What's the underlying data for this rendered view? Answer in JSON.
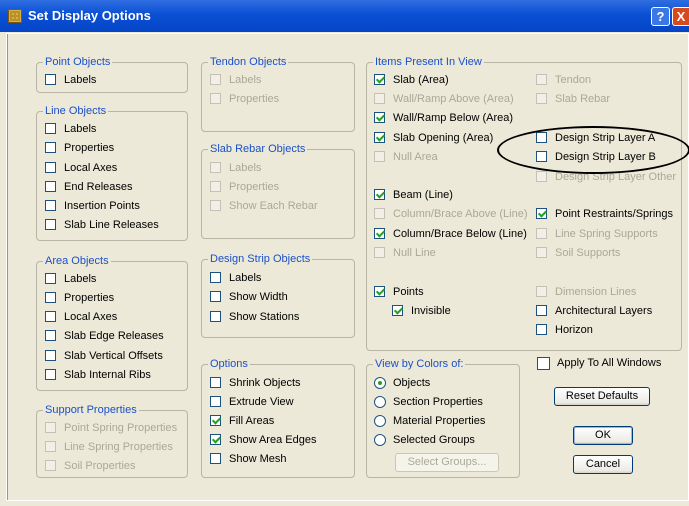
{
  "window": {
    "title": "Set Display Options",
    "help_label": "?",
    "close_label": "X"
  },
  "groups": {
    "point_objects": {
      "title": "Point Objects",
      "items": [
        {
          "label": "Labels",
          "checked": false
        }
      ]
    },
    "line_objects": {
      "title": "Line Objects",
      "items": [
        {
          "label": "Labels",
          "checked": false
        },
        {
          "label": "Properties",
          "checked": false
        },
        {
          "label": "Local Axes",
          "checked": false
        },
        {
          "label": "End Releases",
          "checked": false
        },
        {
          "label": "Insertion Points",
          "checked": false
        },
        {
          "label": "Slab Line Releases",
          "checked": false
        }
      ]
    },
    "area_objects": {
      "title": "Area Objects",
      "items": [
        {
          "label": "Labels",
          "checked": false
        },
        {
          "label": "Properties",
          "checked": false
        },
        {
          "label": "Local Axes",
          "checked": false
        },
        {
          "label": "Slab Edge Releases",
          "checked": false
        },
        {
          "label": "Slab Vertical Offsets",
          "checked": false
        },
        {
          "label": "Slab Internal Ribs",
          "checked": false
        }
      ]
    },
    "support_properties": {
      "title": "Support Properties",
      "items": [
        {
          "label": "Point Spring Properties",
          "checked": false,
          "enabled": false
        },
        {
          "label": "Line Spring Properties",
          "checked": false,
          "enabled": false
        },
        {
          "label": "Soil Properties",
          "checked": false,
          "enabled": false
        }
      ]
    },
    "tendon_objects": {
      "title": "Tendon Objects",
      "items": [
        {
          "label": "Labels",
          "checked": false,
          "enabled": false
        },
        {
          "label": "Properties",
          "checked": false,
          "enabled": false
        }
      ]
    },
    "slab_rebar_objects": {
      "title": "Slab Rebar Objects",
      "items": [
        {
          "label": "Labels",
          "checked": false,
          "enabled": false
        },
        {
          "label": "Properties",
          "checked": false,
          "enabled": false
        },
        {
          "label": "Show Each Rebar",
          "checked": false,
          "enabled": false
        }
      ]
    },
    "design_strip_objects": {
      "title": "Design Strip Objects",
      "items": [
        {
          "label": "Labels",
          "checked": false
        },
        {
          "label": "Show Width",
          "checked": false
        },
        {
          "label": "Show Stations",
          "checked": false
        }
      ]
    },
    "options": {
      "title": "Options",
      "items": [
        {
          "label": "Shrink Objects",
          "checked": false
        },
        {
          "label": "Extrude View",
          "checked": false
        },
        {
          "label": "Fill Areas",
          "checked": true
        },
        {
          "label": "Show Area Edges",
          "checked": true
        },
        {
          "label": "Show Mesh",
          "checked": false
        }
      ]
    },
    "items_present": {
      "title": "Items Present In View",
      "left": [
        {
          "label": "Slab (Area)",
          "checked": true
        },
        {
          "label": "Wall/Ramp Above (Area)",
          "checked": false,
          "enabled": false
        },
        {
          "label": "Wall/Ramp Below (Area)",
          "checked": true
        },
        {
          "label": "Slab Opening (Area)",
          "checked": true
        },
        {
          "label": "Null Area",
          "checked": false,
          "enabled": false
        },
        {
          "label": "Beam (Line)",
          "checked": true
        },
        {
          "label": "Column/Brace Above (Line)",
          "checked": false,
          "enabled": false
        },
        {
          "label": "Column/Brace Below (Line)",
          "checked": true
        },
        {
          "label": "Null Line",
          "checked": false,
          "enabled": false
        },
        {
          "label": "Points",
          "checked": true
        },
        {
          "label": "Invisible",
          "checked": true
        }
      ],
      "right": [
        {
          "label": "Tendon",
          "checked": false,
          "enabled": false
        },
        {
          "label": "Slab Rebar",
          "checked": false,
          "enabled": false
        },
        {
          "label": "Design Strip Layer A",
          "checked": false
        },
        {
          "label": "Design Strip Layer B",
          "checked": false
        },
        {
          "label": "Design Strip Layer Other",
          "checked": false,
          "enabled": false
        },
        {
          "label": "Point Restraints/Springs",
          "checked": true
        },
        {
          "label": "Line Spring Supports",
          "checked": false,
          "enabled": false
        },
        {
          "label": "Soil Supports",
          "checked": false,
          "enabled": false
        },
        {
          "label": "Dimension Lines",
          "checked": false,
          "enabled": false
        },
        {
          "label": "Architectural Layers",
          "checked": false
        },
        {
          "label": "Horizon",
          "checked": false
        }
      ]
    },
    "view_by_colors": {
      "title": "View by Colors of:",
      "options": [
        {
          "label": "Objects",
          "selected": true
        },
        {
          "label": "Section Properties",
          "selected": false
        },
        {
          "label": "Material Properties",
          "selected": false
        },
        {
          "label": "Selected Groups",
          "selected": false
        }
      ],
      "select_groups_label": "Select Groups..."
    }
  },
  "apply_all": {
    "label": "Apply To All Windows",
    "checked": false
  },
  "buttons": {
    "reset_defaults": "Reset Defaults",
    "ok": "OK",
    "cancel": "Cancel"
  }
}
